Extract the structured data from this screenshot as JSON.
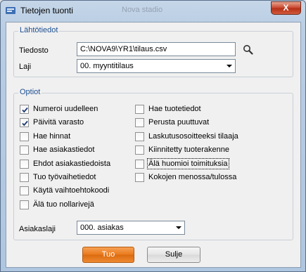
{
  "window": {
    "title": "Tietojen tuonti",
    "background_tab": "Nova stadio",
    "close_glyph": "X"
  },
  "source": {
    "legend": "Lähtötiedot",
    "file_label": "Tiedosto",
    "file_value": "C:\\NOVA9\\YR1\\tilaus.csv",
    "type_label": "Laji",
    "type_value": "00. myyntitilaus"
  },
  "options": {
    "legend": "Optiot",
    "left": [
      {
        "label": "Numeroi uudelleen",
        "checked": true
      },
      {
        "label": "Päivitä varasto",
        "checked": true
      },
      {
        "label": "Hae hinnat",
        "checked": false
      },
      {
        "label": "Hae asiakastiedot",
        "checked": false
      },
      {
        "label": "Ehdot asiakastiedoista",
        "checked": false
      },
      {
        "label": "Tuo työvaihetiedot",
        "checked": false
      },
      {
        "label": "Käytä vaihtoehtokoodi",
        "checked": false
      },
      {
        "label": "Älä tuo nollarivejä",
        "checked": false
      }
    ],
    "right": [
      {
        "label": "Hae tuotetiedot",
        "checked": false
      },
      {
        "label": "Perusta puuttuvat",
        "checked": false
      },
      {
        "label": "Laskutusosoitteeksi tilaaja",
        "checked": false
      },
      {
        "label": "Kiinnitetty tuoterakenne",
        "checked": false
      },
      {
        "label": "Älä huomioi toimituksia",
        "checked": false
      },
      {
        "label": "Kokojen menossa/tulossa",
        "checked": false
      }
    ],
    "customer_type_label": "Asiakaslaji",
    "customer_type_value": "000. asiakas"
  },
  "buttons": {
    "import": "Tuo",
    "close": "Sulje"
  },
  "colors": {
    "accent": "#e9791c",
    "legend": "#1d4f91"
  }
}
